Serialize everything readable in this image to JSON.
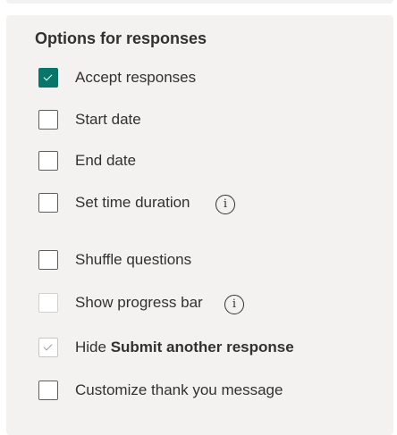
{
  "panel": {
    "title": "Options for responses"
  },
  "options": [
    {
      "label": "Accept responses",
      "state": "checked"
    },
    {
      "label": "Start date",
      "state": "unchecked"
    },
    {
      "label": "End date",
      "state": "unchecked"
    },
    {
      "label": "Set time duration",
      "state": "unchecked",
      "info_icon": "info-icon",
      "info_glyph": "i"
    },
    {
      "label": "Shuffle questions",
      "state": "unchecked"
    },
    {
      "label": "Show progress bar",
      "state": "disabled-unchecked",
      "info_icon": "info-icon",
      "info_glyph": "i"
    },
    {
      "label_prefix": "Hide ",
      "label_bold": "Submit another response",
      "state": "disabled-checked"
    },
    {
      "label": "Customize thank you message",
      "state": "unchecked"
    }
  ],
  "colors": {
    "accent": "#077568",
    "panel_bg": "#f3f2f1",
    "text": "#323130"
  }
}
